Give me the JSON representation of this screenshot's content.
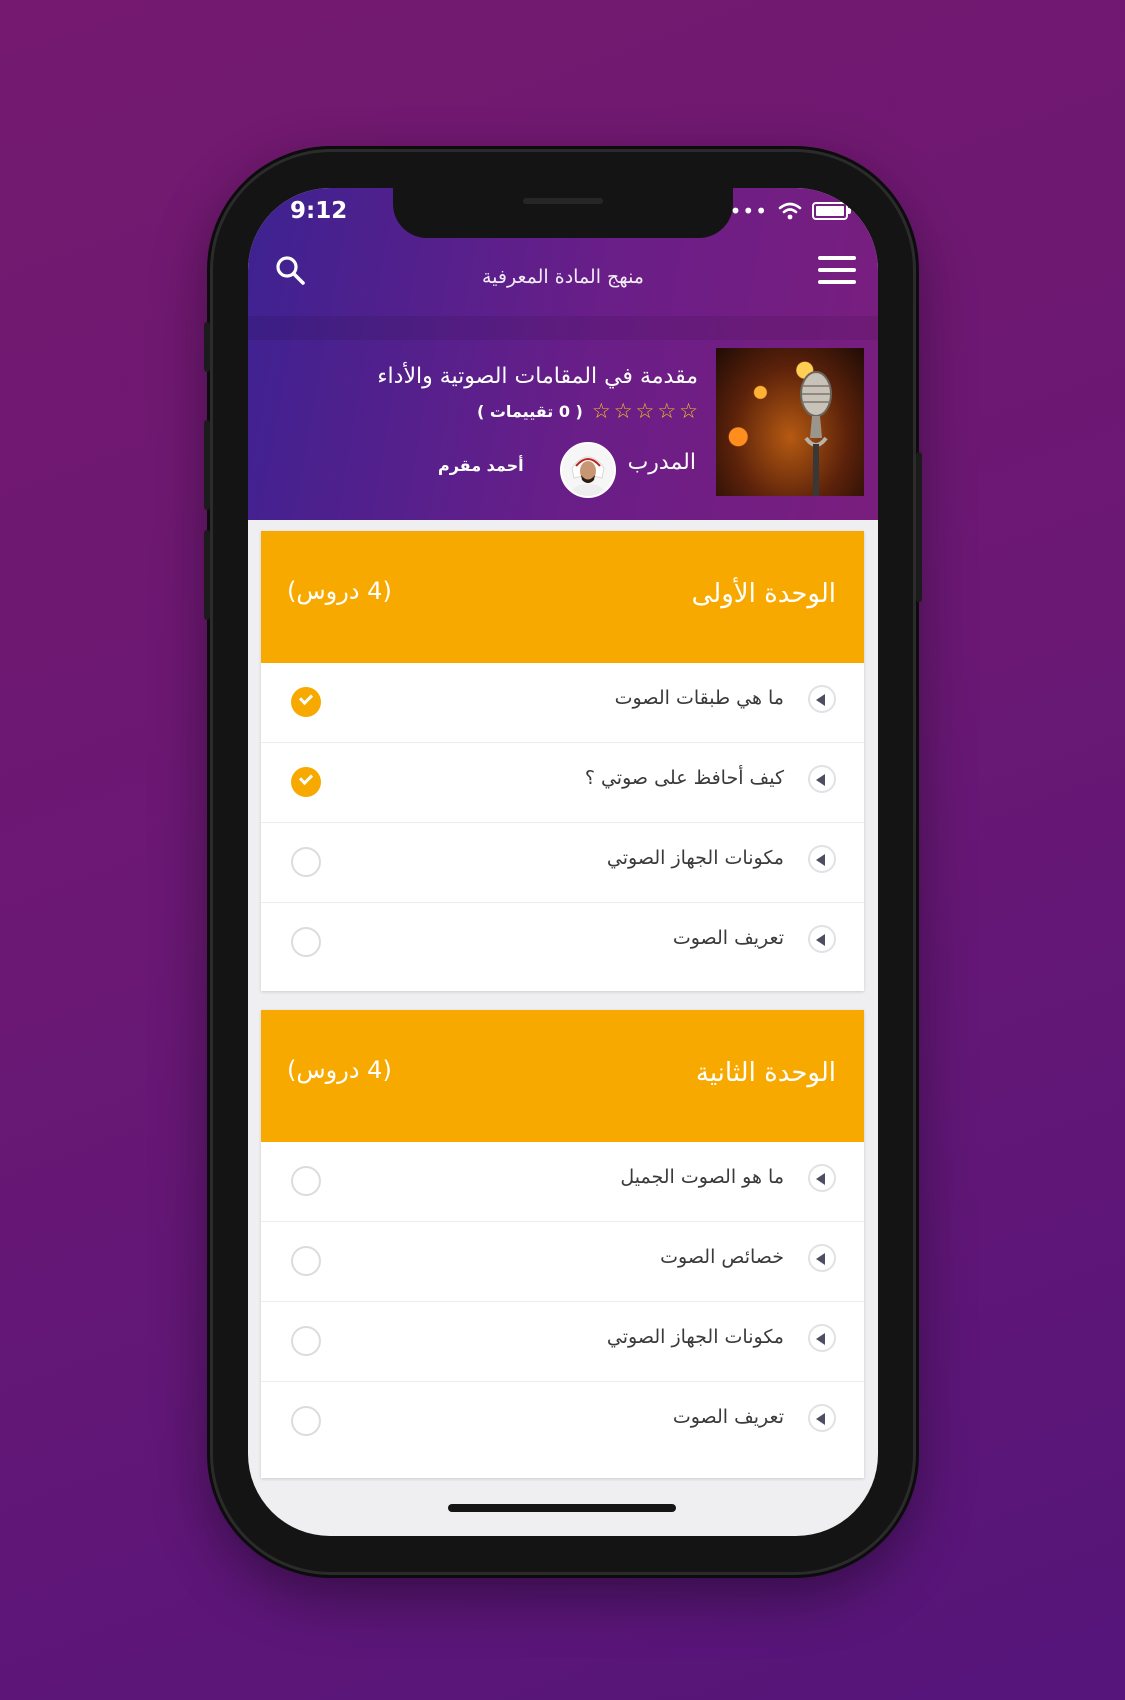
{
  "status_bar": {
    "time": "9:12"
  },
  "top_bar": {
    "title": "منهج المادة المعرفية",
    "search_icon": "search-icon",
    "menu_icon": "hamburger-menu-icon"
  },
  "course": {
    "title": "مقدمة في المقامات الصوتية والأداء",
    "stars": 5,
    "rating_text": "( 0 تقييمات )",
    "trainer_label": "المدرب",
    "trainer_name": "أحمد مقرم"
  },
  "units": [
    {
      "title": "الوحدة الأولى",
      "count": "(4 دروس)",
      "lessons": [
        {
          "title": "ما هي طبقات الصوت",
          "completed": true
        },
        {
          "title": "كيف أحافظ على صوتي ؟",
          "completed": true
        },
        {
          "title": "مكونات الجهاز الصوتي",
          "completed": false
        },
        {
          "title": "تعريف الصوت",
          "completed": false
        }
      ]
    },
    {
      "title": "الوحدة الثانية",
      "count": "(4 دروس)",
      "lessons": [
        {
          "title": "ما هو الصوت الجميل",
          "completed": false
        },
        {
          "title": "خصائص الصوت",
          "completed": false
        },
        {
          "title": "مكونات الجهاز الصوتي",
          "completed": false
        },
        {
          "title": "تعريف الصوت",
          "completed": false
        }
      ]
    }
  ],
  "colors": {
    "accent": "#f8a900",
    "header_start": "#3d2291",
    "header_end": "#7a1e7e",
    "background": "#6b1874"
  }
}
